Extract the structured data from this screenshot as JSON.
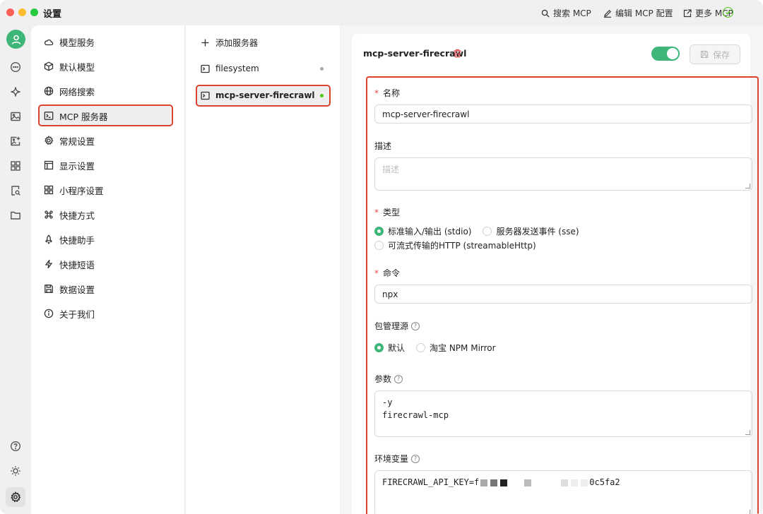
{
  "app": {
    "title": "设置"
  },
  "topbar": {
    "search_mcp": "搜索 MCP",
    "edit_config": "编辑 MCP 配置",
    "more_mcp": "更多 MCP"
  },
  "nav": {
    "items": [
      {
        "label": "模型服务",
        "icon": "cloud-icon"
      },
      {
        "label": "默认模型",
        "icon": "cube-icon"
      },
      {
        "label": "网络搜索",
        "icon": "globe-icon"
      },
      {
        "label": "MCP 服务器",
        "icon": "terminal-icon"
      },
      {
        "label": "常规设置",
        "icon": "gear-icon"
      },
      {
        "label": "显示设置",
        "icon": "layout-icon"
      },
      {
        "label": "小程序设置",
        "icon": "grid-icon"
      },
      {
        "label": "快捷方式",
        "icon": "command-icon"
      },
      {
        "label": "快捷助手",
        "icon": "rocket-icon"
      },
      {
        "label": "快捷短语",
        "icon": "zap-icon"
      },
      {
        "label": "数据设置",
        "icon": "save-icon"
      },
      {
        "label": "关于我们",
        "icon": "info-icon"
      }
    ]
  },
  "servers": {
    "add_label": "添加服务器",
    "items": [
      {
        "name": "filesystem",
        "status_color": "#aaaaaa"
      },
      {
        "name": "mcp-server-firecrawl",
        "status_color": "#52c41a"
      }
    ]
  },
  "detail": {
    "title": "mcp-server-firecrawl",
    "enabled": true,
    "save_label": "保存",
    "name_label": "名称",
    "name_value": "mcp-server-firecrawl",
    "desc_label": "描述",
    "desc_placeholder": "描述",
    "type_label": "类型",
    "type_options": [
      "标准输入/输出 (stdio)",
      "服务器发送事件 (sse)",
      "可流式传输的HTTP (streamableHttp)"
    ],
    "type_selected": 0,
    "command_label": "命令",
    "command_value": "npx",
    "pkg_label": "包管理源",
    "pkg_options": [
      "默认",
      "淘宝 NPM Mirror"
    ],
    "pkg_selected": 0,
    "args_label": "参数",
    "args_lines": [
      "-y",
      "firecrawl-mcp"
    ],
    "env_label": "环境变量",
    "env_prefix": "FIRECRAWL_API_KEY=f",
    "env_suffix": "0c5fa2"
  },
  "colors": {
    "accent": "#3eb579",
    "highlight": "#d9432f",
    "required": "#e5484d"
  }
}
